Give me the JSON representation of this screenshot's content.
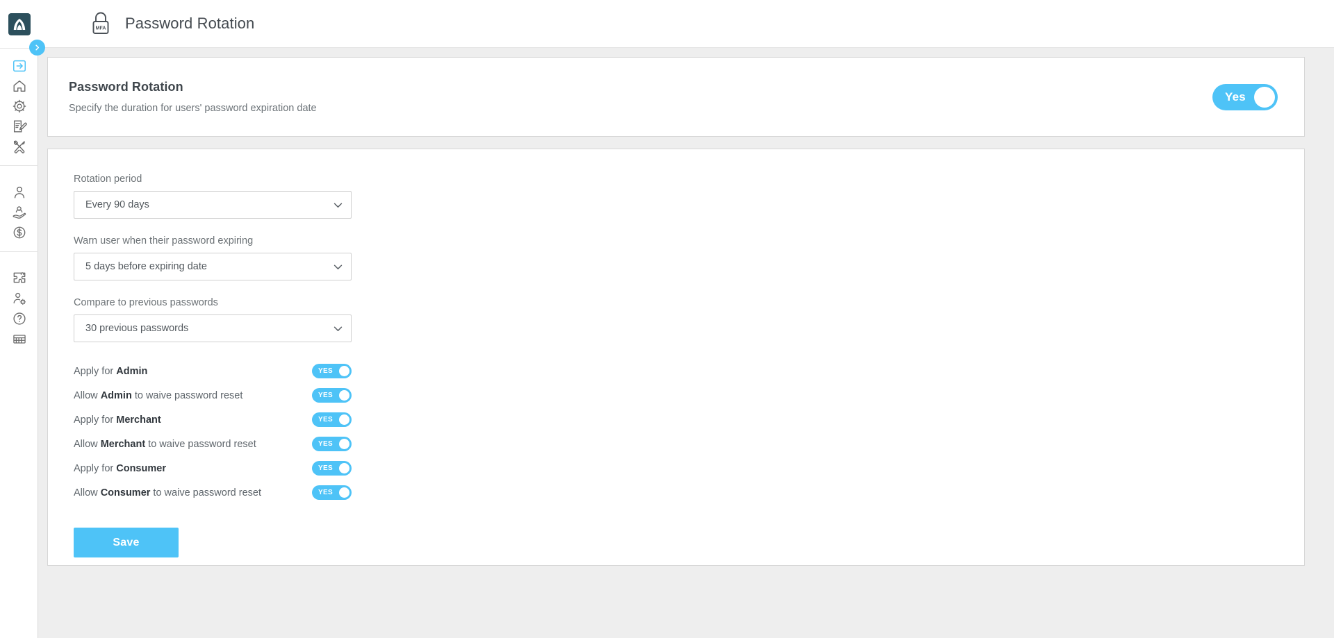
{
  "app": {
    "logo_name": "brand-logo",
    "collapse_icon": "chevron-right-icon"
  },
  "topbar": {
    "icon": "mfa-lock-icon",
    "lock_badge_text": "MFA",
    "title": "Password Rotation"
  },
  "sidebar": {
    "groups": [
      {
        "items": [
          {
            "icon": "login-arrow-icon",
            "name": "sidebar-item-login",
            "active": true
          },
          {
            "icon": "home-icon",
            "name": "sidebar-item-home",
            "active": false
          },
          {
            "icon": "gear-icon",
            "name": "sidebar-item-settings",
            "active": false
          },
          {
            "icon": "form-edit-icon",
            "name": "sidebar-item-forms",
            "active": false
          },
          {
            "icon": "tools-icon",
            "name": "sidebar-item-tools",
            "active": false
          }
        ]
      },
      {
        "items": [
          {
            "icon": "user-icon",
            "name": "sidebar-item-users",
            "active": false
          },
          {
            "icon": "hand-user-icon",
            "name": "sidebar-item-merchants",
            "active": false
          },
          {
            "icon": "dollar-coin-icon",
            "name": "sidebar-item-payments",
            "active": false
          }
        ]
      },
      {
        "items": [
          {
            "icon": "puzzle-icon",
            "name": "sidebar-item-plugins",
            "active": false
          },
          {
            "icon": "user-settings-icon",
            "name": "sidebar-item-account-settings",
            "active": false
          },
          {
            "icon": "question-circle-icon",
            "name": "sidebar-item-help",
            "active": false
          },
          {
            "icon": "calculator-icon",
            "name": "sidebar-item-calculator",
            "active": false
          }
        ]
      }
    ]
  },
  "header_card": {
    "title": "Password Rotation",
    "subtitle": "Specify the duration for users' password expiration date",
    "master_toggle": {
      "label": "Yes",
      "state": "on"
    }
  },
  "form": {
    "fields": [
      {
        "name": "rotation-period",
        "label": "Rotation period",
        "value": "Every 90 days",
        "caret": "chevron-down-icon"
      },
      {
        "name": "warn-user",
        "label": "Warn user when their password expiring",
        "value": "5 days before expiring date",
        "caret": "chevron-down-icon"
      },
      {
        "name": "compare-previous",
        "label": "Compare to previous passwords",
        "value": "30 previous passwords",
        "caret": "chevron-down-icon"
      }
    ],
    "toggle_rows": [
      {
        "name": "apply-admin",
        "prefix": "Apply for ",
        "strong": "Admin",
        "suffix": "",
        "toggle_label": "YES",
        "state": "on"
      },
      {
        "name": "allow-admin-waive",
        "prefix": "Allow ",
        "strong": "Admin",
        "suffix": " to waive password reset",
        "toggle_label": "YES",
        "state": "on"
      },
      {
        "name": "apply-merchant",
        "prefix": "Apply for ",
        "strong": "Merchant",
        "suffix": "",
        "toggle_label": "YES",
        "state": "on"
      },
      {
        "name": "allow-merchant-waive",
        "prefix": "Allow ",
        "strong": "Merchant",
        "suffix": " to waive password reset",
        "toggle_label": "YES",
        "state": "on"
      },
      {
        "name": "apply-consumer",
        "prefix": "Apply for ",
        "strong": "Consumer",
        "suffix": "",
        "toggle_label": "YES",
        "state": "on"
      },
      {
        "name": "allow-consumer-waive",
        "prefix": "Allow ",
        "strong": "Consumer",
        "suffix": " to waive password reset",
        "toggle_label": "YES",
        "state": "on"
      }
    ],
    "save_label": "Save"
  },
  "colors": {
    "accent": "#4ec3f7",
    "logo_bg": "#2c4f5c",
    "page_bg": "#eeeeee",
    "panel_bg": "#ffffff",
    "text_dark": "#3f464c",
    "text_muted": "#6b7277"
  }
}
